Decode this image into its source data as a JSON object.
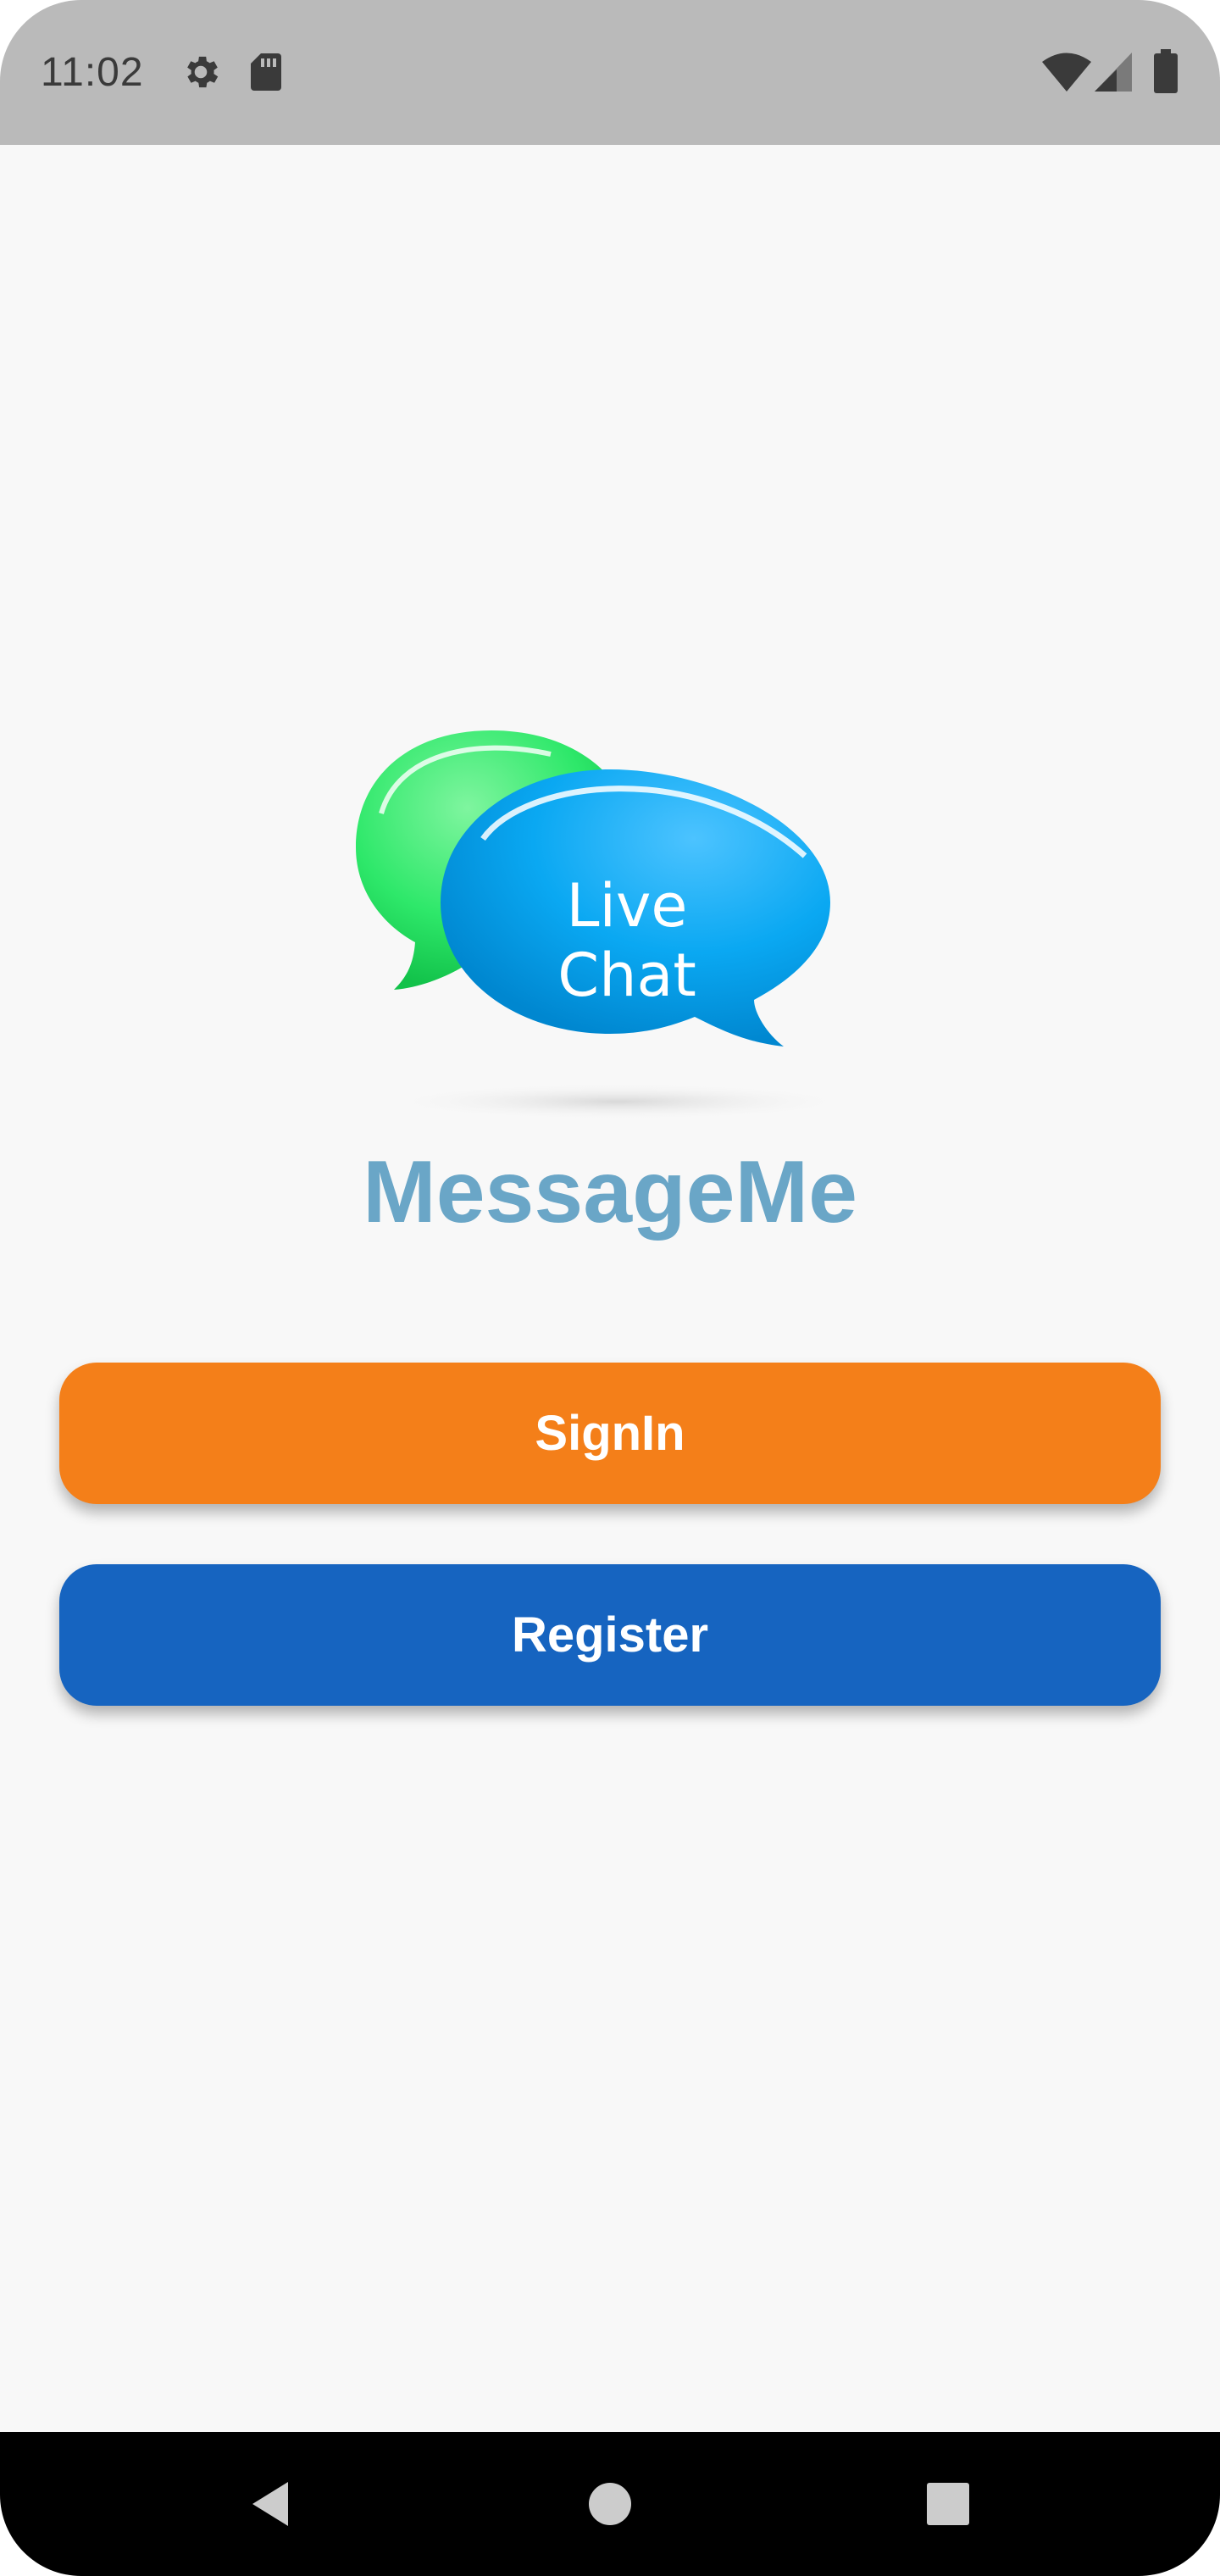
{
  "status_bar": {
    "time": "11:02",
    "icons": [
      "gear-icon",
      "sd-card-icon",
      "wifi-icon",
      "signal-icon",
      "battery-icon"
    ]
  },
  "logo": {
    "bubble_text": "Live Chat",
    "colors": {
      "green": "#2ee86a",
      "blue": "#0aa8f2"
    }
  },
  "app": {
    "name": "MessageMe"
  },
  "buttons": {
    "signin_label": "SignIn",
    "register_label": "Register"
  },
  "colors": {
    "signin": "#f47f19",
    "register": "#1664c0",
    "app_name": "#6aa6c7",
    "status_bar": "#bababa",
    "background": "#f8f8f8"
  },
  "nav_bar": {
    "icons": [
      "back-icon",
      "home-icon",
      "recents-icon"
    ]
  }
}
